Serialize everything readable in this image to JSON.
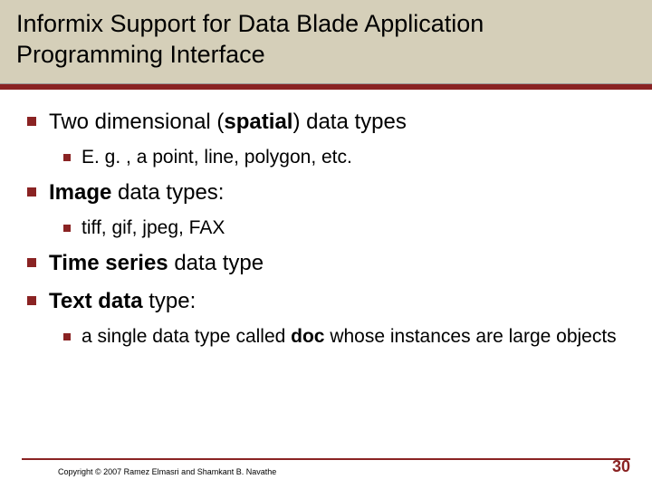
{
  "title": "Informix Support for Data Blade Application Programming Interface",
  "bullets": {
    "b1_pre": "Two dimensional (",
    "b1_bold": "spatial",
    "b1_post": ") data types",
    "b1_sub": "E. g. , a point, line, polygon, etc.",
    "b2_bold": "Image",
    "b2_post": " data types:",
    "b2_sub": "tiff, gif, jpeg, FAX",
    "b3_bold": "Time series",
    "b3_post": " data type",
    "b4_bold": "Text data",
    "b4_post": " type:",
    "b4_sub_pre": "a single data type called ",
    "b4_sub_bold": "doc",
    "b4_sub_post": " whose instances are large objects"
  },
  "copyright": "Copyright © 2007 Ramez Elmasri and Shamkant B. Navathe",
  "pagenum": "30"
}
